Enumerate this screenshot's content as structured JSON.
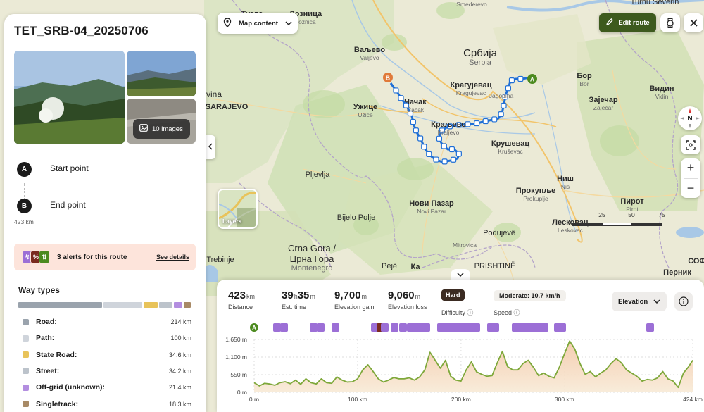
{
  "route": {
    "title": "TET_SRB-04_20250706",
    "images_label": "10 images",
    "start_label": "Start point",
    "end_label": "End point",
    "start_marker": "A",
    "end_marker": "B",
    "distance_small": "423 km",
    "alerts_text": "3 alerts for this route",
    "alerts_details": "See details"
  },
  "waytypes": {
    "title": "Way types",
    "items": [
      {
        "name": "Road:",
        "value": "214 km",
        "color": "#9aa3ad"
      },
      {
        "name": "Path:",
        "value": "100 km",
        "color": "#cfd4db"
      },
      {
        "name": "State Road:",
        "value": "34.6 km",
        "color": "#e8c35a"
      },
      {
        "name": "Street:",
        "value": "34.2 km",
        "color": "#bcc3cb"
      },
      {
        "name": "Off-grid (unknown):",
        "value": "21.4 km",
        "color": "#b38ee0"
      },
      {
        "name": "Singletrack:",
        "value": "18.3 km",
        "color": "#a88a66"
      }
    ],
    "bar_fractions": [
      0.506,
      0.236,
      0.082,
      0.081,
      0.051,
      0.043
    ]
  },
  "map": {
    "map_content_label": "Map content",
    "edit_route_label": "Edit route",
    "compass_label": "N",
    "layers_label": "Layers",
    "zoom_in": "+",
    "zoom_out": "−",
    "scale_labels": [
      "25",
      "50",
      "75"
    ],
    "places": [
      {
        "name": "Тузла",
        "sub": "Tuzla"
      },
      {
        "name": "Лозница",
        "sub": "Loznica"
      },
      {
        "name": "Smederevo",
        "sub": ""
      },
      {
        "name": "Turnu Severin",
        "sub": ""
      },
      {
        "name": "Ваљево",
        "sub": "Valjevo"
      },
      {
        "name": "Србија",
        "sub": "Serbia"
      },
      {
        "name": "Бор",
        "sub": "Bor"
      },
      {
        "name": "Крагујевац",
        "sub": "Kragujevac"
      },
      {
        "name": "Јагодина",
        "sub": "Jagodina"
      },
      {
        "name": "Зајечар",
        "sub": "Zaječar"
      },
      {
        "name": "Видин",
        "sub": "Vidin"
      },
      {
        "name": "Ужице",
        "sub": "Užice"
      },
      {
        "name": "Чачак",
        "sub": "Čačak"
      },
      {
        "name": "Краљево",
        "sub": "Kraljevo"
      },
      {
        "name": "Крушевац",
        "sub": "Kruševac"
      },
      {
        "name": "SARAJEVO",
        "sub": ""
      },
      {
        "name": "vina",
        "sub": ""
      },
      {
        "name": "Pljevlja",
        "sub": ""
      },
      {
        "name": "Ниш",
        "sub": "Niš"
      },
      {
        "name": "Прокупље",
        "sub": "Prokuplje"
      },
      {
        "name": "Пирот",
        "sub": "Pirot"
      },
      {
        "name": "Bijelo Polje",
        "sub": ""
      },
      {
        "name": "Нови Пазар",
        "sub": "Novi Pazar"
      },
      {
        "name": "Лесковац",
        "sub": "Leskovac"
      },
      {
        "name": "Crna Gora /",
        "sub": ""
      },
      {
        "name": "Црна Гора",
        "sub": "Montenegro"
      },
      {
        "name": "Podujevë",
        "sub": ""
      },
      {
        "name": "Mitrovica",
        "sub": ""
      },
      {
        "name": "Trebinje",
        "sub": ""
      },
      {
        "name": "Pejë",
        "sub": ""
      },
      {
        "name": "PRISHTINË",
        "sub": ""
      },
      {
        "name": "Перник",
        "sub": ""
      },
      {
        "name": "СОФ",
        "sub": ""
      },
      {
        "name": "Ка",
        "sub": ""
      }
    ]
  },
  "stats": {
    "distance": {
      "value": "423",
      "unit": "km",
      "label": "Distance"
    },
    "time": {
      "h": "39",
      "m": "35",
      "h_unit": "h",
      "m_unit": "m",
      "label": "Est. time"
    },
    "gain": {
      "value": "9,700",
      "unit": "m",
      "label": "Elevation gain"
    },
    "loss": {
      "value": "9,060",
      "unit": "m",
      "label": "Elevation loss"
    },
    "difficulty": {
      "badge": "Hard",
      "label": "Difficulty"
    },
    "speed": {
      "badge": "Moderate: 10.7 km/h",
      "label": "Speed"
    },
    "select_label": "Elevation"
  },
  "colors": {
    "accent_green": "#3d5a1e",
    "route_blue": "#1f6fd6",
    "alert_bg": "#fde4db",
    "hard_badge": "#3b2b22",
    "end_marker": "#e07a3a",
    "start_marker": "#4c8a1f",
    "alert_purple": "#9c6fd6",
    "alert_dark": "#7a2a1e",
    "alert_green": "#4c8a1f"
  },
  "chart_data": {
    "type": "area",
    "xlabel": "",
    "ylabel": "",
    "x_ticks": [
      "0 m",
      "100 km",
      "200 km",
      "300 km",
      "424 km"
    ],
    "x_tick_values": [
      0,
      100,
      200,
      300,
      424
    ],
    "y_ticks": [
      "0 m",
      "550 m",
      "1,100 m",
      "1,650 m"
    ],
    "y_tick_values": [
      0,
      550,
      1100,
      1650
    ],
    "xlim": [
      0,
      424
    ],
    "ylim": [
      0,
      1650
    ],
    "x": [
      0,
      5,
      10,
      15,
      20,
      25,
      30,
      35,
      40,
      45,
      50,
      55,
      60,
      65,
      70,
      75,
      80,
      85,
      90,
      95,
      100,
      105,
      110,
      115,
      120,
      125,
      130,
      135,
      140,
      145,
      150,
      155,
      160,
      165,
      170,
      175,
      180,
      185,
      190,
      195,
      200,
      205,
      210,
      215,
      220,
      225,
      230,
      235,
      240,
      245,
      250,
      255,
      260,
      265,
      270,
      275,
      280,
      285,
      290,
      295,
      300,
      305,
      310,
      315,
      320,
      325,
      330,
      335,
      340,
      345,
      350,
      355,
      360,
      365,
      370,
      375,
      380,
      385,
      390,
      395,
      400,
      405,
      410,
      415,
      420,
      424
    ],
    "y": [
      300,
      200,
      280,
      260,
      220,
      300,
      330,
      270,
      380,
      250,
      420,
      300,
      260,
      420,
      300,
      280,
      480,
      380,
      320,
      330,
      420,
      700,
      860,
      650,
      420,
      320,
      380,
      460,
      420,
      420,
      450,
      380,
      480,
      700,
      1250,
      1000,
      750,
      1000,
      500,
      380,
      350,
      700,
      950,
      640,
      560,
      500,
      520,
      920,
      1280,
      800,
      700,
      700,
      900,
      1000,
      780,
      520,
      600,
      500,
      450,
      780,
      1200,
      1600,
      1350,
      900,
      560,
      650,
      480,
      600,
      700,
      900,
      1050,
      920,
      700,
      600,
      500,
      350,
      400,
      380,
      450,
      650,
      420,
      350,
      150,
      600,
      800,
      1000
    ]
  },
  "alert_markers_label": "A"
}
